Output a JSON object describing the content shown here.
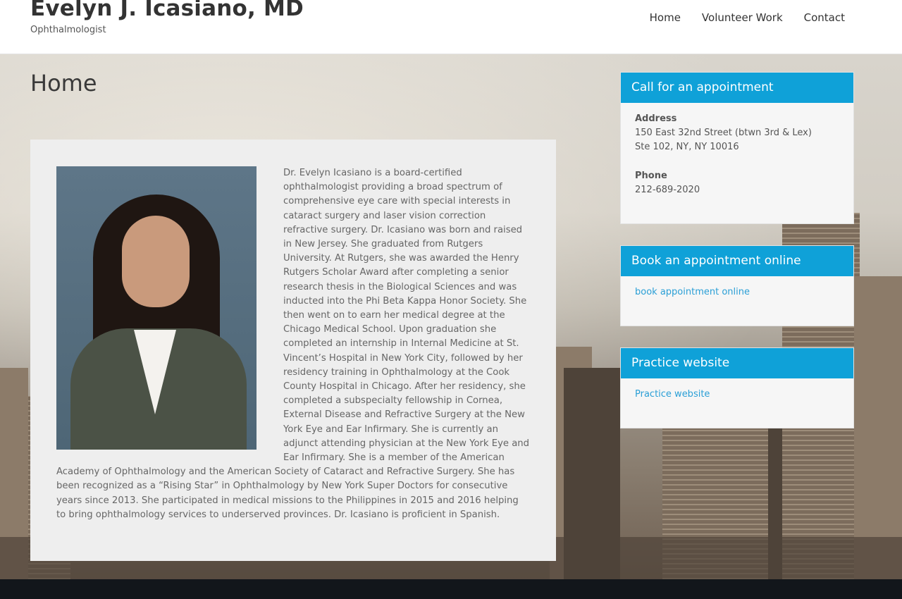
{
  "header": {
    "site_title": "Evelyn J. Icasiano, MD",
    "tagline": "Ophthalmologist",
    "nav": [
      {
        "label": "Home"
      },
      {
        "label": "Volunteer Work"
      },
      {
        "label": "Contact"
      }
    ]
  },
  "main": {
    "page_title": "Home",
    "bio": "Dr. Evelyn Icasiano is a board-certified ophthalmologist providing a broad spectrum of comprehensive eye care with special interests in cataract surgery and laser vision correction refractive surgery. Dr. Icasiano was born and raised in New Jersey. She graduated from Rutgers University. At Rutgers, she was awarded the Henry Rutgers Scholar Award after completing a senior research thesis in the Biological Sciences and was inducted into the Phi Beta Kappa Honor Society. She then went on to earn her medical degree at the Chicago Medical School. Upon graduation she completed an internship in Internal Medicine at St. Vincent’s Hospital in New York City, followed by her residency training in Ophthalmology at the Cook County Hospital in Chicago. After her residency, she completed a subspecialty fellowship in Cornea, External Disease and Refractive Surgery at the New York Eye and Ear Infirmary. She is currently an adjunct attending physician at the New York Eye and Ear Infirmary. She is a member of the American Academy of Ophthalmology and the American Society of Cataract and Refractive Surgery. She has been recognized as a “Rising Star” in Ophthalmology by New York Super Doctors for consecutive years since 2013. She participated in medical missions to the Philippines in 2015 and 2016 helping to bring ophthalmology services to underserved provinces. Dr. Icasiano is proficient in Spanish."
  },
  "sidebar": {
    "appointment": {
      "title": "Call for an appointment",
      "address_label": "Address",
      "address_line1": "150 East 32nd Street (btwn 3rd & Lex)",
      "address_line2": "Ste 102, NY, NY 10016",
      "phone_label": "Phone",
      "phone": "212-689-2020"
    },
    "book_online": {
      "title": "Book an appointment online",
      "link": "book appointment online"
    },
    "practice": {
      "title": "Practice website",
      "link": "Practice website"
    }
  },
  "colors": {
    "accent": "#0fa1d8",
    "link": "#2a9fd6",
    "footer": "#12161b"
  }
}
